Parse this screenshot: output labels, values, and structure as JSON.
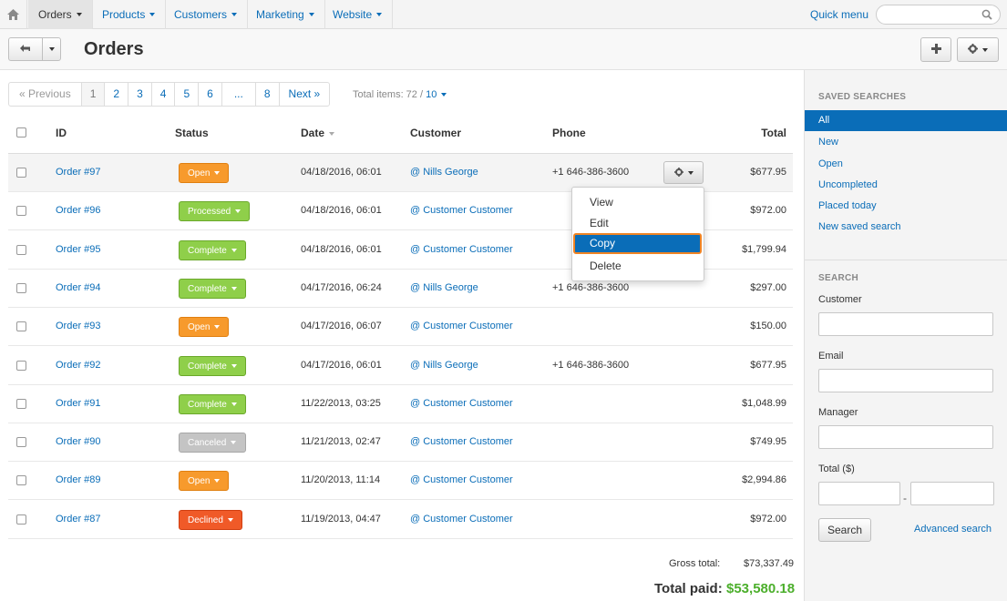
{
  "nav": {
    "items": [
      {
        "label": "Orders",
        "active": true
      },
      {
        "label": "Products"
      },
      {
        "label": "Customers"
      },
      {
        "label": "Marketing"
      },
      {
        "label": "Website"
      }
    ],
    "quick_menu": "Quick menu",
    "search_placeholder": ""
  },
  "toolbar": {
    "title": "Orders"
  },
  "pagination": {
    "prev": "« Previous",
    "pages": [
      "1",
      "2",
      "3",
      "4",
      "5",
      "6",
      "...",
      "8"
    ],
    "next": "Next »",
    "total_label": "Total items: 72 /",
    "per_page": "10"
  },
  "table": {
    "headers": {
      "id": "ID",
      "status": "Status",
      "date": "Date",
      "customer": "Customer",
      "phone": "Phone",
      "total": "Total"
    },
    "rows": [
      {
        "id": "Order #97",
        "status": "Open",
        "status_class": "open",
        "date": "04/18/2016, 06:01",
        "customer": "@ Nills George",
        "phone": "+1 646-386-3600",
        "total": "$677.95"
      },
      {
        "id": "Order #96",
        "status": "Processed",
        "status_class": "processed",
        "date": "04/18/2016, 06:01",
        "customer": "@ Customer Customer",
        "phone": "",
        "total": "$972.00"
      },
      {
        "id": "Order #95",
        "status": "Complete",
        "status_class": "complete",
        "date": "04/18/2016, 06:01",
        "customer": "@ Customer Customer",
        "phone": "",
        "total": "$1,799.94"
      },
      {
        "id": "Order #94",
        "status": "Complete",
        "status_class": "complete",
        "date": "04/17/2016, 06:24",
        "customer": "@ Nills George",
        "phone": "+1 646-386-3600",
        "total": "$297.00"
      },
      {
        "id": "Order #93",
        "status": "Open",
        "status_class": "open",
        "date": "04/17/2016, 06:07",
        "customer": "@ Customer Customer",
        "phone": "",
        "total": "$150.00"
      },
      {
        "id": "Order #92",
        "status": "Complete",
        "status_class": "complete",
        "date": "04/17/2016, 06:01",
        "customer": "@ Nills George",
        "phone": "+1 646-386-3600",
        "total": "$677.95"
      },
      {
        "id": "Order #91",
        "status": "Complete",
        "status_class": "complete",
        "date": "11/22/2013, 03:25",
        "customer": "@ Customer Customer",
        "phone": "",
        "total": "$1,048.99"
      },
      {
        "id": "Order #90",
        "status": "Canceled",
        "status_class": "canceled",
        "date": "11/21/2013, 02:47",
        "customer": "@ Customer Customer",
        "phone": "",
        "total": "$749.95"
      },
      {
        "id": "Order #89",
        "status": "Open",
        "status_class": "open",
        "date": "11/20/2013, 11:14",
        "customer": "@ Customer Customer",
        "phone": "",
        "total": "$2,994.86"
      },
      {
        "id": "Order #87",
        "status": "Declined",
        "status_class": "declined",
        "date": "11/19/2013, 04:47",
        "customer": "@ Customer Customer",
        "phone": "",
        "total": "$972.00"
      }
    ]
  },
  "dropdown": {
    "items": [
      "View",
      "Edit",
      "Copy",
      "Delete"
    ],
    "active": "Copy"
  },
  "totals": {
    "gross_label": "Gross total:",
    "gross_value": "$73,337.49",
    "paid_label": "Total paid:",
    "paid_value": "$53,580.18"
  },
  "sidebar": {
    "saved_heading": "SAVED SEARCHES",
    "saved": [
      "All",
      "New",
      "Open",
      "Uncompleted",
      "Placed today",
      "New saved search"
    ],
    "search_heading": "SEARCH",
    "customer_label": "Customer",
    "email_label": "Email",
    "manager_label": "Manager",
    "total_label": "Total ($)",
    "dash": "-",
    "search_button": "Search",
    "advanced": "Advanced search"
  },
  "colors": {
    "link": "#0a6db8",
    "open": "#f79a2c",
    "complete": "#8fcf4a",
    "canceled": "#c4c4c4",
    "declined": "#f05a28",
    "paid": "#4caf2c",
    "highlight": "#f08424"
  }
}
